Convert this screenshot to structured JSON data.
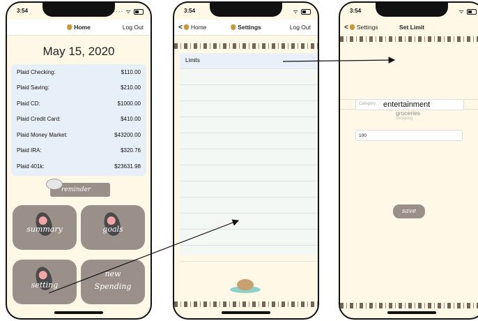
{
  "status_time": "3:54",
  "screen1": {
    "nav": {
      "title": "Home",
      "right": "Log Out"
    },
    "date": "May 15, 2020",
    "accounts": [
      {
        "name": "Plaid Checking:",
        "amount": "$110.00"
      },
      {
        "name": "Plaid Saving:",
        "amount": "$210.00"
      },
      {
        "name": "Plaid CD:",
        "amount": "$1000.00"
      },
      {
        "name": "Plaid Credit Card:",
        "amount": "$410.00"
      },
      {
        "name": "Plaid Money Market:",
        "amount": "$43200.00"
      },
      {
        "name": "Plaid IRA:",
        "amount": "$320.76"
      },
      {
        "name": "Plaid 401k:",
        "amount": "$23631.98"
      }
    ],
    "reminder_label": "reminder",
    "tiles": {
      "summary": "summary",
      "goals": "goals",
      "setting": "setting",
      "new_spending_1": "new",
      "new_spending_2": "Spending"
    }
  },
  "screen2": {
    "nav": {
      "back": "Home",
      "title": "Settings",
      "right": "Log Out"
    },
    "list": [
      "Limits"
    ]
  },
  "screen3": {
    "nav": {
      "back": "Settings",
      "title": "Set Limit"
    },
    "category_placeholder": "Category",
    "picker": {
      "selected": "entertainment",
      "next": "groceries",
      "next2": "shopping"
    },
    "amount_value": "100",
    "save_label": "save"
  },
  "colors": {
    "background": "#fff8e7",
    "tile": "#9b8f8a",
    "account_panel": "#e7eff8",
    "arrow": "#111111"
  }
}
